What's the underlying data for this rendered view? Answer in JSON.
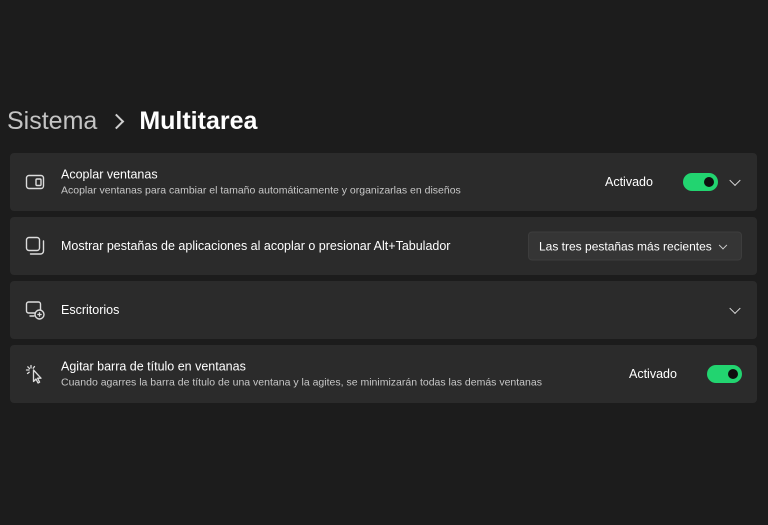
{
  "breadcrumb": {
    "parent": "Sistema",
    "current": "Multitarea"
  },
  "settings": [
    {
      "title": "Acoplar ventanas",
      "description": "Acoplar ventanas para cambiar el tamaño automáticamente y organizarlas en diseños",
      "status": "Activado",
      "toggle_on": true,
      "icon": "snap-windows-icon"
    },
    {
      "title": "Mostrar pestañas de aplicaciones al acoplar o presionar Alt+Tabulador",
      "dropdown_value": "Las tres pestañas más recientes",
      "icon": "app-tabs-icon"
    },
    {
      "title": "Escritorios",
      "icon": "desktops-icon"
    },
    {
      "title": "Agitar barra de título en ventanas",
      "description": "Cuando agarres la barra de título de una ventana y la agites, se minimizarán todas las demás ventanas",
      "status": "Activado",
      "toggle_on": true,
      "icon": "shake-cursor-icon"
    }
  ],
  "colors": {
    "background": "#1c1c1c",
    "card": "#2b2b2b",
    "accent": "#22d470"
  }
}
